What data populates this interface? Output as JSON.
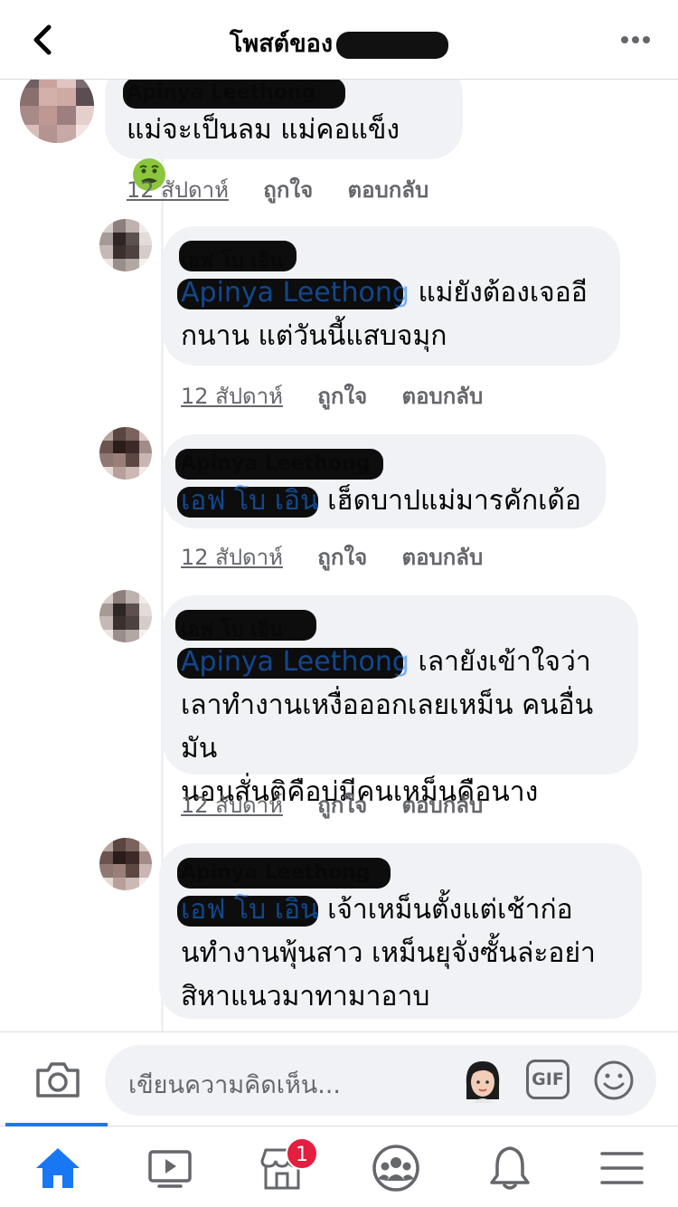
{
  "header": {
    "title": "โพสต์ของ",
    "back_icon": "chevron-left-icon",
    "more_icon": "more-horizontal-icon"
  },
  "comments": [
    {
      "author": "Apinya Leethong",
      "text": "แม่จะเป็นลม แม่คอแข็ง",
      "emoji": "nauseated-face",
      "time": "12 สัปดาห์",
      "like": "ถูกใจ",
      "reply": "ตอบกลับ"
    },
    {
      "author": "เอฟ โบ เอิน",
      "tag": "Apinya Leethong",
      "text_line1": "แม่ยังต้องเจออี",
      "text_line2": "กนาน แต่วันนี้แสบจมุก",
      "time": "12 สัปดาห์",
      "like": "ถูกใจ",
      "reply": "ตอบกลับ"
    },
    {
      "author": "Apinya Leethong",
      "tag": "เอฟ โบ เอิน",
      "text": "เฮ็ดบาปแม่มารคักเด้อ",
      "time": "12 สัปดาห์",
      "like": "ถูกใจ",
      "reply": "ตอบกลับ"
    },
    {
      "author": "เอฟ โบ เอิน",
      "tag": "Apinya Leethong",
      "text_line1": "เลายังเข้าใจว่า",
      "text_line2": "เลาทำงานเหงื่อออกเลยเหม็น คนอื่นมัน",
      "text_line3": "นอนสั่นติคือบ่มีคนเหม็นคือนาง",
      "time": "12 สัปดาห์",
      "like": "ถูกใจ",
      "reply": "ตอบกลับ"
    },
    {
      "author": "Apinya Leethong",
      "tag": "เอฟ โบ เอิน",
      "text_line1": "เจ้าเหม็นตั้งแต่เช้าก่อ",
      "text_line2": "นทำงานพุ้นสาว เหม็นยุจั่งซั้นล่ะอย่า",
      "text_line3": "สิหาแนวมาทามาอาบ"
    }
  ],
  "composer": {
    "placeholder": "เขียนความคิดเห็น...",
    "gif_label": "GIF",
    "camera_icon": "camera-icon",
    "sticker_icon": "avatar-sticker-icon",
    "smile_icon": "smiley-icon"
  },
  "tabbar": {
    "marketplace_badge": "1",
    "tabs": [
      "home-icon",
      "video-icon",
      "marketplace-icon",
      "groups-icon",
      "bell-icon",
      "menu-icon"
    ],
    "active": "home-icon"
  },
  "colors": {
    "accent": "#1877f2",
    "bubble": "#f0f2f5",
    "muted_text": "#65676b",
    "badge": "#e41e3f"
  }
}
